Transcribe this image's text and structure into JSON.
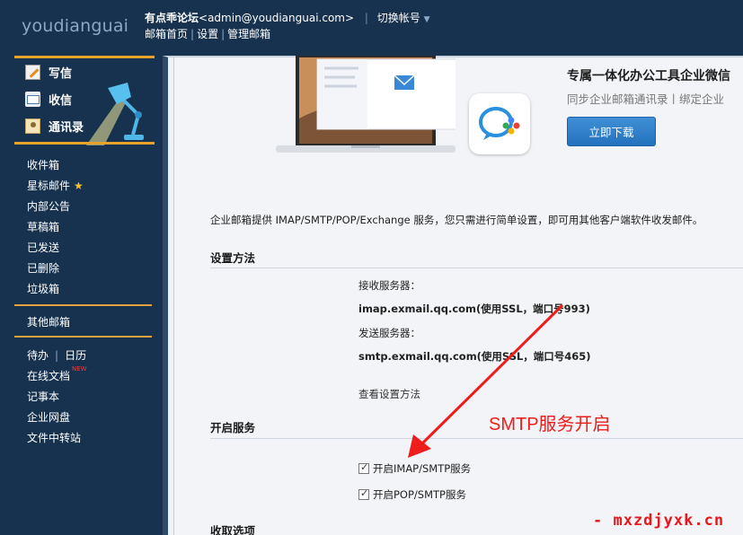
{
  "header": {
    "logo": "youdianguai",
    "forum_name": "有点乖论坛",
    "email": "<admin@youdianguai.com>",
    "separator": "|",
    "switch_account": "切换帐号",
    "nav": [
      "邮箱首页",
      "设置",
      "管理邮箱"
    ],
    "nav_separator": "|"
  },
  "sidebar": {
    "primary": [
      "写信",
      "收信",
      "通讯录"
    ],
    "folders": [
      "收件箱",
      "星标邮件",
      "内部公告",
      "草稿箱",
      "已发送",
      "已删除",
      "垃圾箱"
    ],
    "other_mail": "其他邮箱",
    "todo": "待办",
    "calendar": "日历",
    "tools_sep": "|",
    "online_docs": "在线文档",
    "new_tag": "NEW",
    "notebook": "记事本",
    "netdisk": "企业网盘",
    "file_transfer": "文件中转站",
    "star_glyph": "★"
  },
  "promo": {
    "title": "专属一体化办公工具企业微信",
    "subtitle": "同步企业邮箱通讯录丨绑定企业",
    "button": "立即下载"
  },
  "main": {
    "intro": "企业邮箱提供 IMAP/SMTP/POP/Exchange 服务，您只需进行简单设置，即可用其他客户端软件收发邮件。",
    "setup_title": "设置方法",
    "incoming_label": "接收服务器：",
    "incoming_value": "imap.exmail.qq.com(使用SSL，端口号993)",
    "outgoing_label": "发送服务器：",
    "outgoing_value": "smtp.exmail.qq.com(使用SSL，端口号465)",
    "view_method": "查看设置方法",
    "service_title": "开启服务",
    "imap_smtp": "开启IMAP/SMTP服务",
    "pop_smtp": "开启POP/SMTP服务",
    "receive_title": "收取选项",
    "imap_checked": true,
    "pop_checked": true
  },
  "annotation": "SMTP服务开启",
  "watermark": "- mxzdjyxk.cn"
}
